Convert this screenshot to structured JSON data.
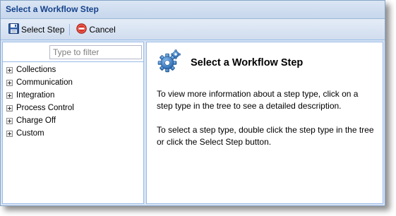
{
  "dialog": {
    "title": "Select a Workflow Step"
  },
  "toolbar": {
    "select_step_label": "Select Step",
    "cancel_label": "Cancel"
  },
  "filter": {
    "placeholder": "Type to filter",
    "value": ""
  },
  "tree": {
    "items": [
      {
        "label": "Collections"
      },
      {
        "label": "Communication"
      },
      {
        "label": "Integration"
      },
      {
        "label": "Process Control"
      },
      {
        "label": "Charge Off"
      },
      {
        "label": "Custom"
      }
    ]
  },
  "detail": {
    "icon": "gear-icon",
    "title": "Select a Workflow Step",
    "paragraph1": "To view more information about a step type, click on a step type in the tree to see a detailed description.",
    "paragraph2": "To select a step type, double click the step type in the tree or click the Select Step button."
  },
  "colors": {
    "title_text": "#15428b",
    "panel_border": "#99bbe8",
    "cancel_icon": "#d8362a",
    "gear_icon": "#2f79c4"
  }
}
